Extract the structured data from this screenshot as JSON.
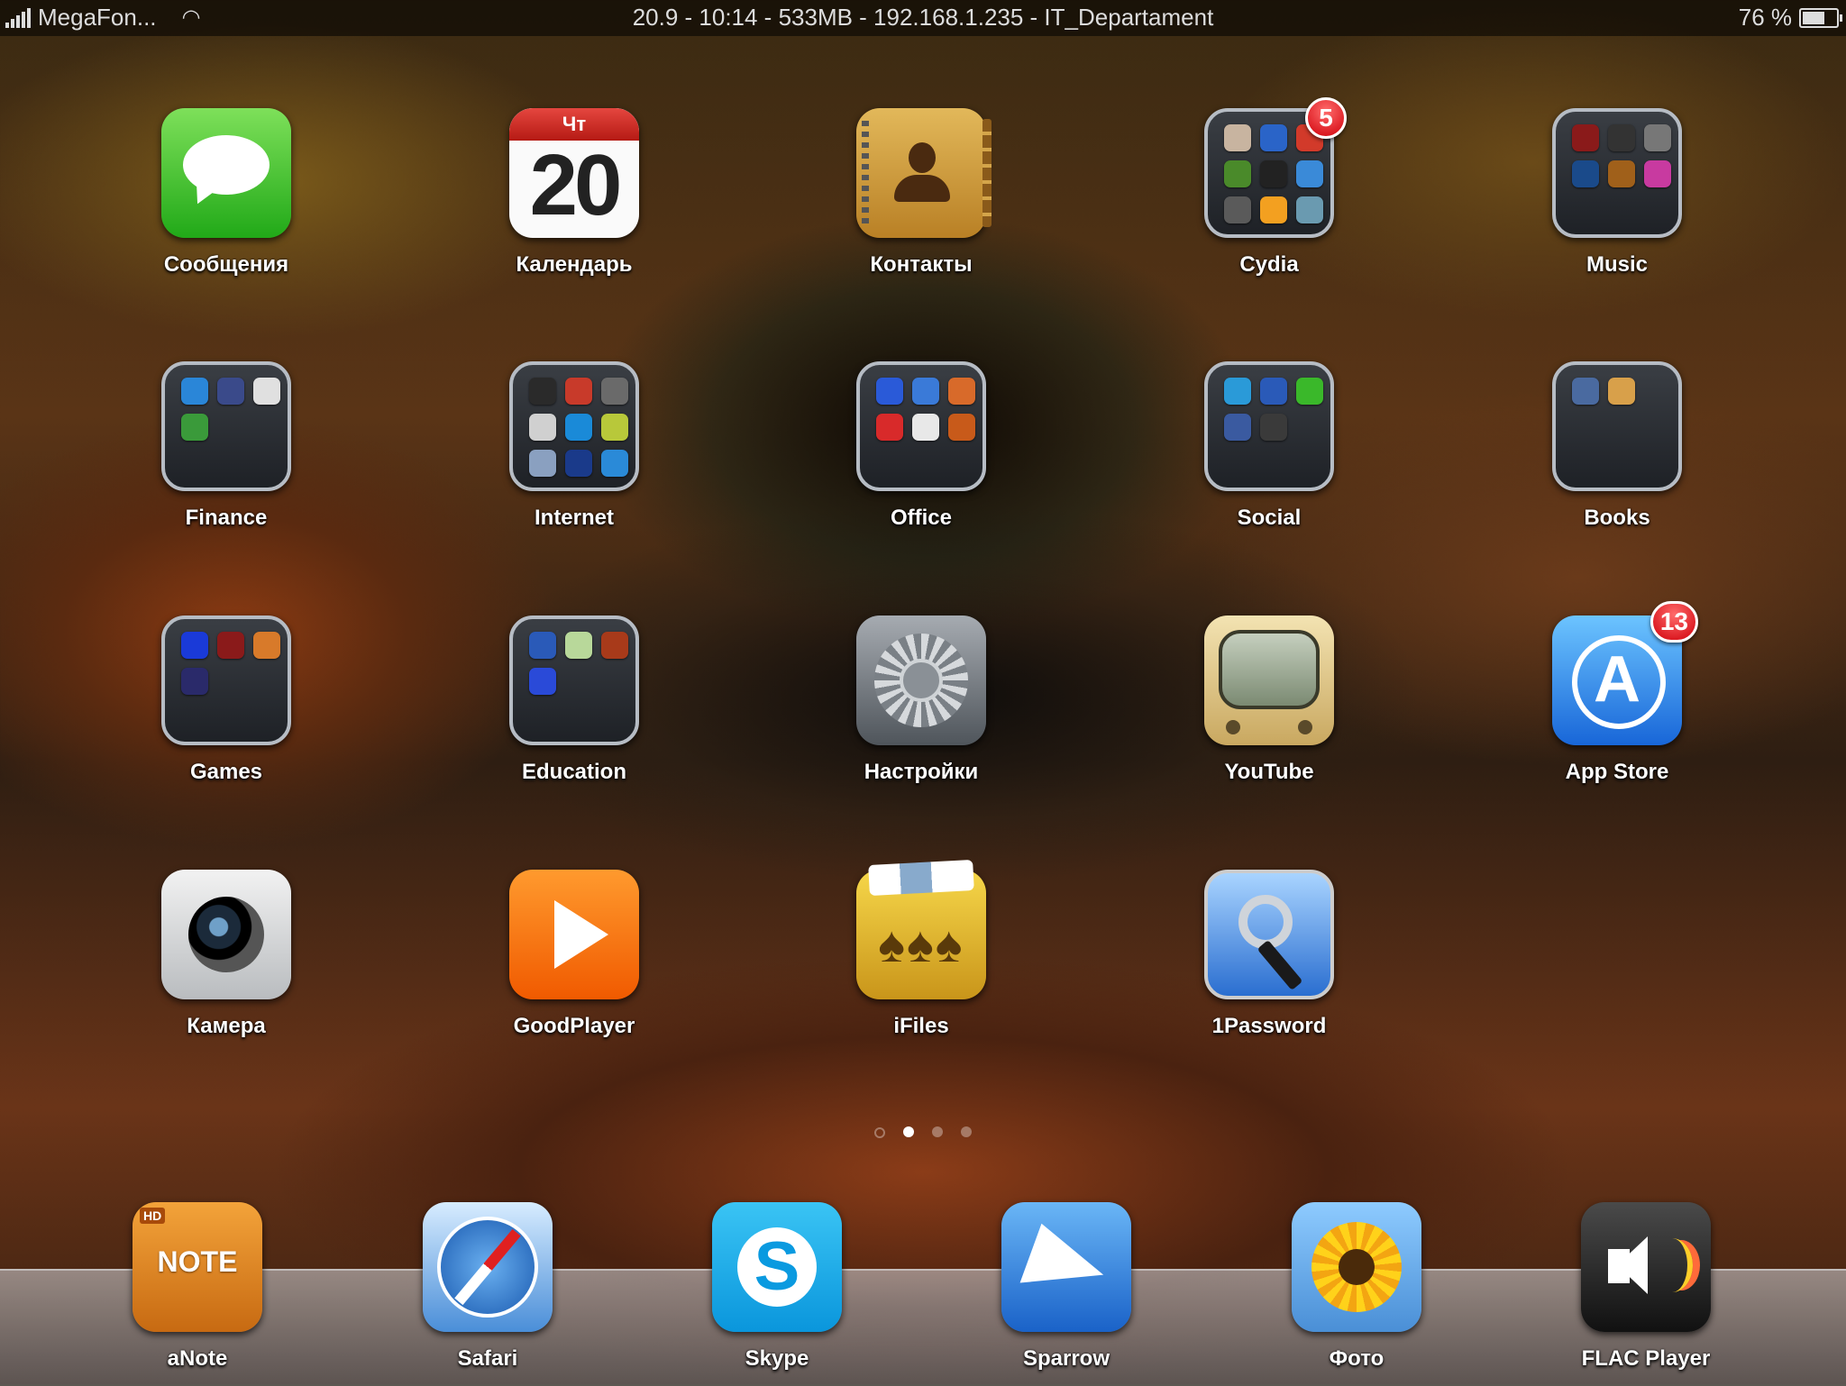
{
  "status_bar": {
    "carrier": "MegaFon...",
    "center_text": "20.9 - 10:14 - 533MB - 192.168.1.235 - IT_Departament",
    "battery_text": "76 %",
    "battery_level": 0.76
  },
  "calendar": {
    "weekday": "Чт",
    "day": "20"
  },
  "apps": [
    {
      "label": "Сообщения",
      "icon": "messages-icon"
    },
    {
      "label": "Календарь",
      "icon": "calendar-icon"
    },
    {
      "label": "Контакты",
      "icon": "contacts-icon"
    },
    {
      "label": "Cydia",
      "icon": "folder-icon",
      "badge": "5"
    },
    {
      "label": "Music",
      "icon": "folder-icon"
    },
    {
      "label": "Finance",
      "icon": "folder-icon"
    },
    {
      "label": "Internet",
      "icon": "folder-icon"
    },
    {
      "label": "Office",
      "icon": "folder-icon"
    },
    {
      "label": "Social",
      "icon": "folder-icon"
    },
    {
      "label": "Books",
      "icon": "folder-icon"
    },
    {
      "label": "Games",
      "icon": "folder-icon"
    },
    {
      "label": "Education",
      "icon": "folder-icon"
    },
    {
      "label": "Настройки",
      "icon": "settings-gear-icon"
    },
    {
      "label": "YouTube",
      "icon": "youtube-tv-icon"
    },
    {
      "label": "App Store",
      "icon": "app-store-icon",
      "badge": "13"
    },
    {
      "label": "Камера",
      "icon": "camera-icon"
    },
    {
      "label": "GoodPlayer",
      "icon": "play-icon"
    },
    {
      "label": "iFiles",
      "icon": "ifiles-icon"
    },
    {
      "label": "1Password",
      "icon": "key-icon"
    }
  ],
  "folders": {
    "cydia": [
      "#c8b4a0",
      "#2a64c8",
      "#d23a2a",
      "#4a8a2a",
      "#222222",
      "#3a8ad8",
      "#5a5a5a",
      "#f3a020",
      "#6a9ab0"
    ],
    "music": [
      "#8a1a1a",
      "#333333",
      "#777777",
      "#1a4a8a",
      "#a0601a",
      "#c83aa0"
    ],
    "finance": [
      "#2a86d8",
      "#3a4a8a",
      "#e0e0e0",
      "#3a9a3a"
    ],
    "internet": [
      "#2a2a2a",
      "#c83a2a",
      "#6a6a6a",
      "#d0d0d0",
      "#1a8ad8",
      "#b8c83a",
      "#8aa0c0",
      "#1a3a8a",
      "#2a8ad8"
    ],
    "office": [
      "#2a5ad8",
      "#3a7ad8",
      "#d86a2a",
      "#d82a2a",
      "#e8e8e8",
      "#c85a1a"
    ],
    "social": [
      "#2a9ad8",
      "#2a5ab8",
      "#3ab82a",
      "#3a5aa0",
      "#3a3a3a"
    ],
    "books": [
      "#4a6aa0",
      "#d8a04a"
    ],
    "games": [
      "#1a3ad8",
      "#8a1a1a",
      "#d87a2a",
      "#2a2a6a"
    ],
    "education": [
      "#2a5ab8",
      "#b8d89a",
      "#a83a1a",
      "#2a4ad8"
    ]
  },
  "page_dots": {
    "count": 4,
    "active_index": 1
  },
  "dock": [
    {
      "label": "aNote",
      "icon": "anote-icon",
      "icon_text": "NOTE",
      "hd_text": "HD"
    },
    {
      "label": "Safari",
      "icon": "safari-compass-icon"
    },
    {
      "label": "Skype",
      "icon": "skype-icon",
      "icon_text": "S"
    },
    {
      "label": "Sparrow",
      "icon": "paper-plane-icon"
    },
    {
      "label": "Фото",
      "icon": "sunflower-photos-icon"
    },
    {
      "label": "FLAC Player",
      "icon": "speaker-icon"
    }
  ]
}
